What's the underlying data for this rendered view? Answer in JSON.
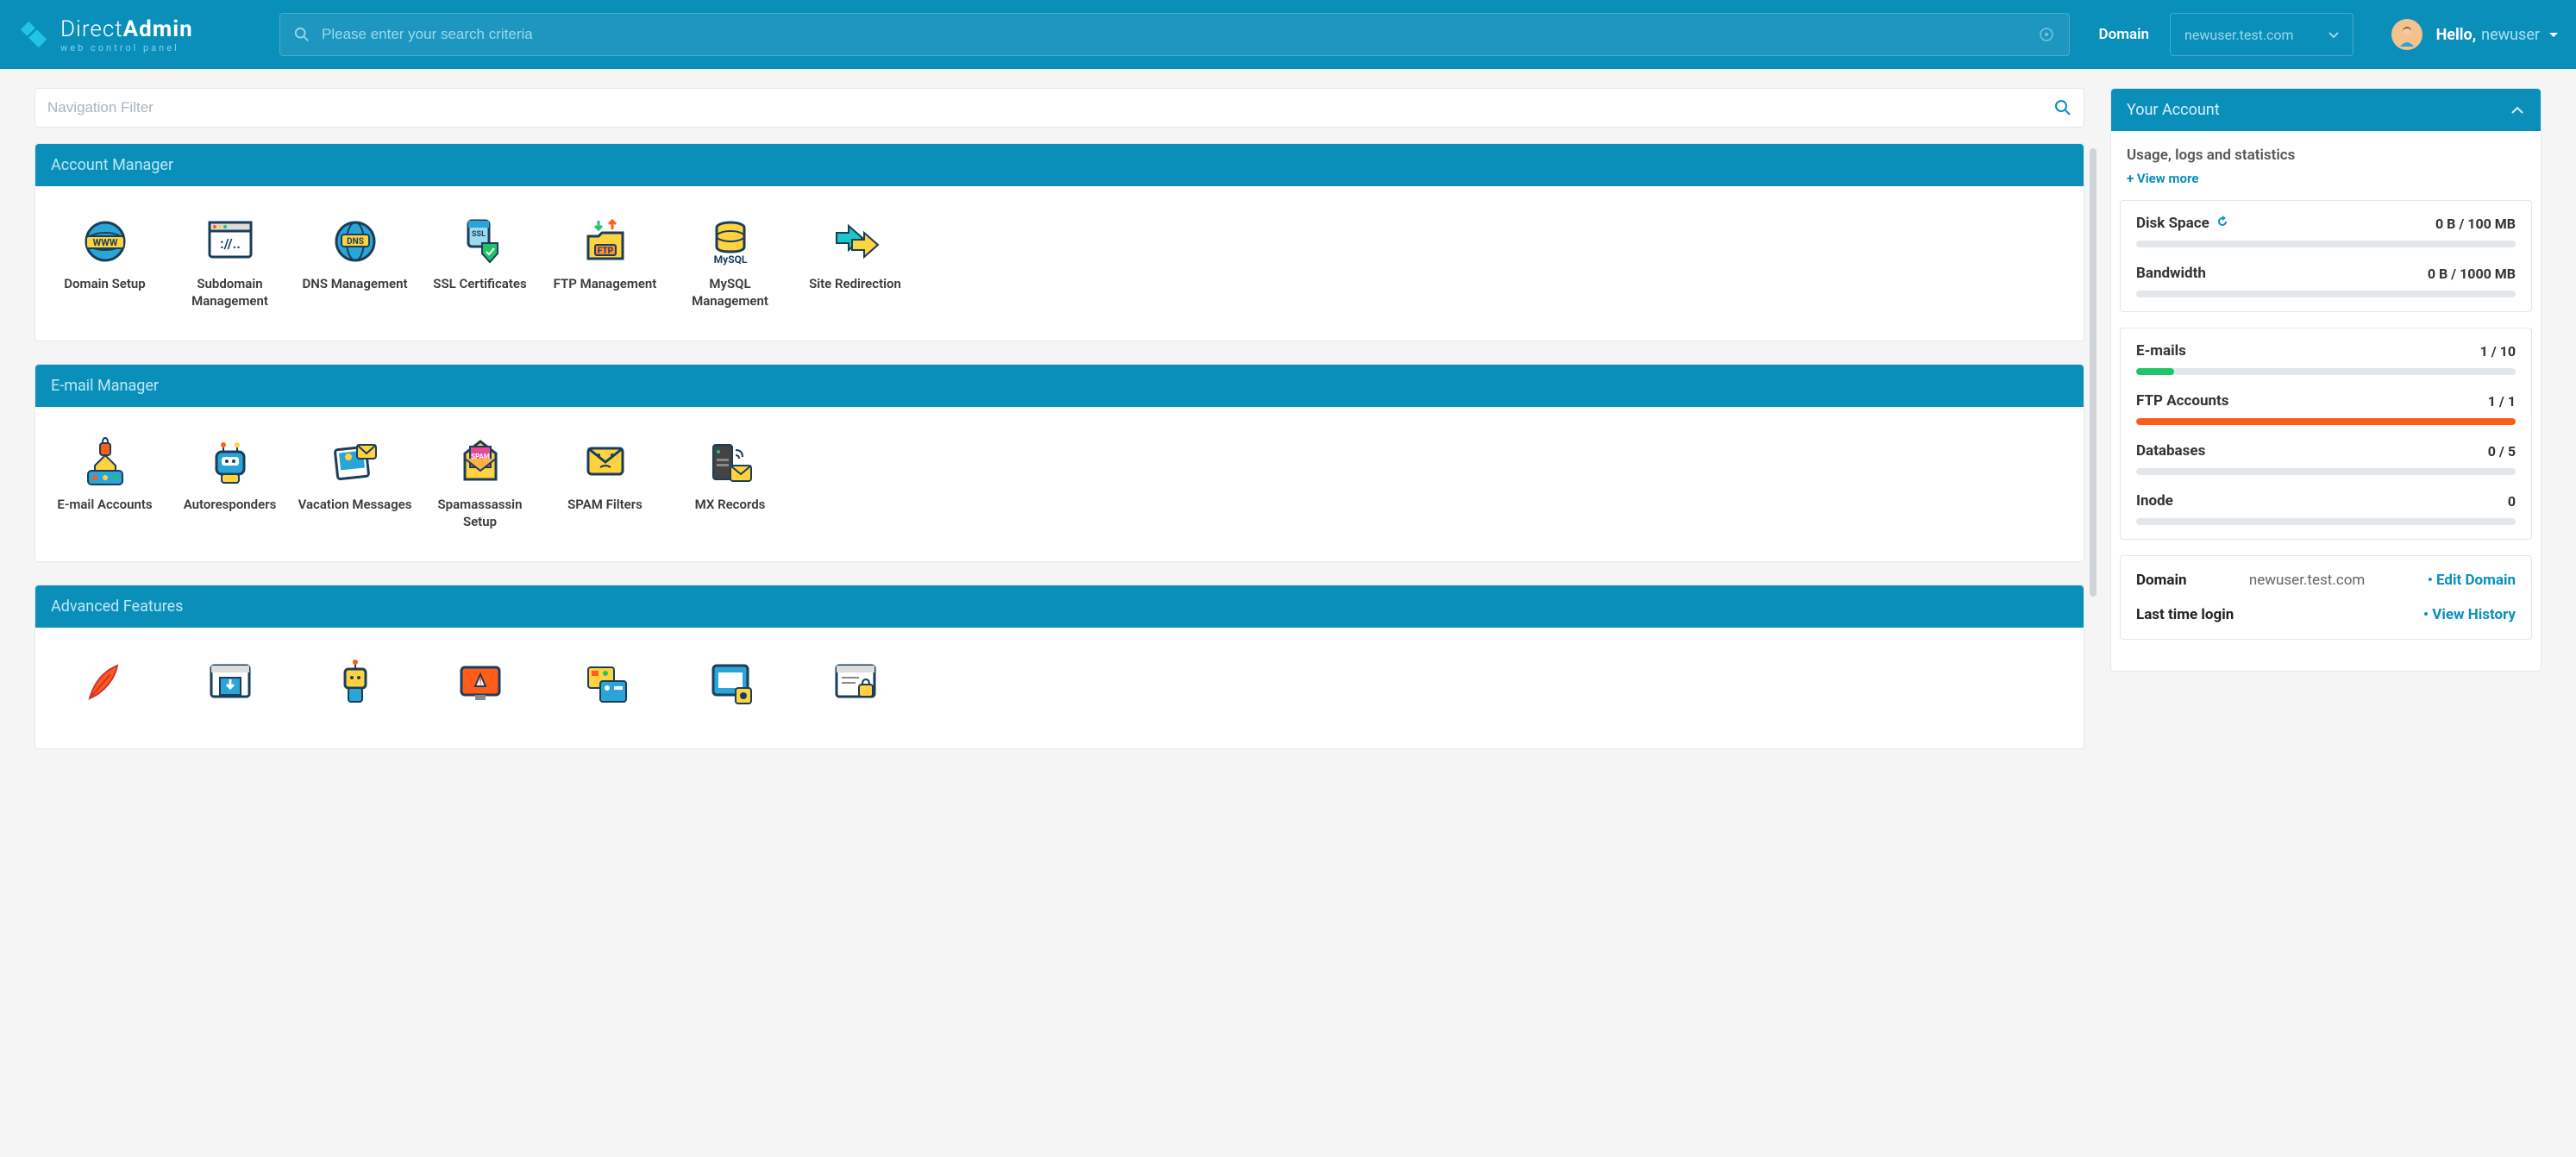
{
  "brand": {
    "title_plain": "Direct",
    "title_bold": "Admin",
    "subtitle": "web control panel"
  },
  "header": {
    "search_placeholder": "Please enter your search criteria",
    "domain_label": "Domain",
    "domain_selected": "newuser.test.com",
    "greeting_prefix": "Hello,",
    "username": "newuser"
  },
  "nav_filter_placeholder": "Navigation Filter",
  "colors": {
    "primary": "#0a8fba",
    "green": "#1fc46b",
    "orange": "#ff5c1a",
    "grey_bar": "#e3e7ea"
  },
  "sections": [
    {
      "title": "Account Manager",
      "items": [
        {
          "label": "Domain Setup",
          "icon": "globe-www"
        },
        {
          "label": "Subdomain Management",
          "icon": "browser-code"
        },
        {
          "label": "DNS Management",
          "icon": "globe-dns"
        },
        {
          "label": "SSL Certificates",
          "icon": "ssl-shield"
        },
        {
          "label": "FTP Management",
          "icon": "ftp-folder"
        },
        {
          "label": "MySQL Management",
          "icon": "mysql-db"
        },
        {
          "label": "Site Redirection",
          "icon": "redirect-arrows"
        }
      ]
    },
    {
      "title": "E-mail Manager",
      "items": [
        {
          "label": "E-mail Accounts",
          "icon": "mail-lock"
        },
        {
          "label": "Autoresponders",
          "icon": "robot"
        },
        {
          "label": "Vacation Messages",
          "icon": "polaroid-mail"
        },
        {
          "label": "Spamassassin Setup",
          "icon": "spam-envelope"
        },
        {
          "label": "SPAM Filters",
          "icon": "spam-face"
        },
        {
          "label": "MX Records",
          "icon": "server-mail"
        }
      ]
    },
    {
      "title": "Advanced Features",
      "items": [
        {
          "label": "",
          "icon": "feather"
        },
        {
          "label": "",
          "icon": "install-box"
        },
        {
          "label": "",
          "icon": "cron-robot"
        },
        {
          "label": "",
          "icon": "error-screen"
        },
        {
          "label": "",
          "icon": "mime-card"
        },
        {
          "label": "",
          "icon": "handlers"
        },
        {
          "label": "",
          "icon": "protect-lock"
        }
      ]
    }
  ],
  "account_panel": {
    "header": "Your Account",
    "usage_label": "Usage, logs and statistics",
    "view_more": "+ View more",
    "group1": [
      {
        "name": "Disk Space",
        "refresh": true,
        "value": "0 B / 100 MB",
        "pct": 0,
        "color": "grey"
      },
      {
        "name": "Bandwidth",
        "refresh": false,
        "value": "0 B / 1000 MB",
        "pct": 0,
        "color": "grey"
      }
    ],
    "group2": [
      {
        "name": "E-mails",
        "value": "1 / 10",
        "pct": 10,
        "color": "green"
      },
      {
        "name": "FTP Accounts",
        "value": "1 / 1",
        "pct": 100,
        "color": "orange"
      },
      {
        "name": "Databases",
        "value": "0 / 5",
        "pct": 0,
        "color": "grey"
      },
      {
        "name": "Inode",
        "value": "0",
        "pct": 0,
        "color": "grey"
      }
    ],
    "info": [
      {
        "key": "Domain",
        "value": "newuser.test.com",
        "link": "Edit Domain"
      },
      {
        "key": "Last time login",
        "value": "",
        "link": "View History"
      }
    ]
  }
}
